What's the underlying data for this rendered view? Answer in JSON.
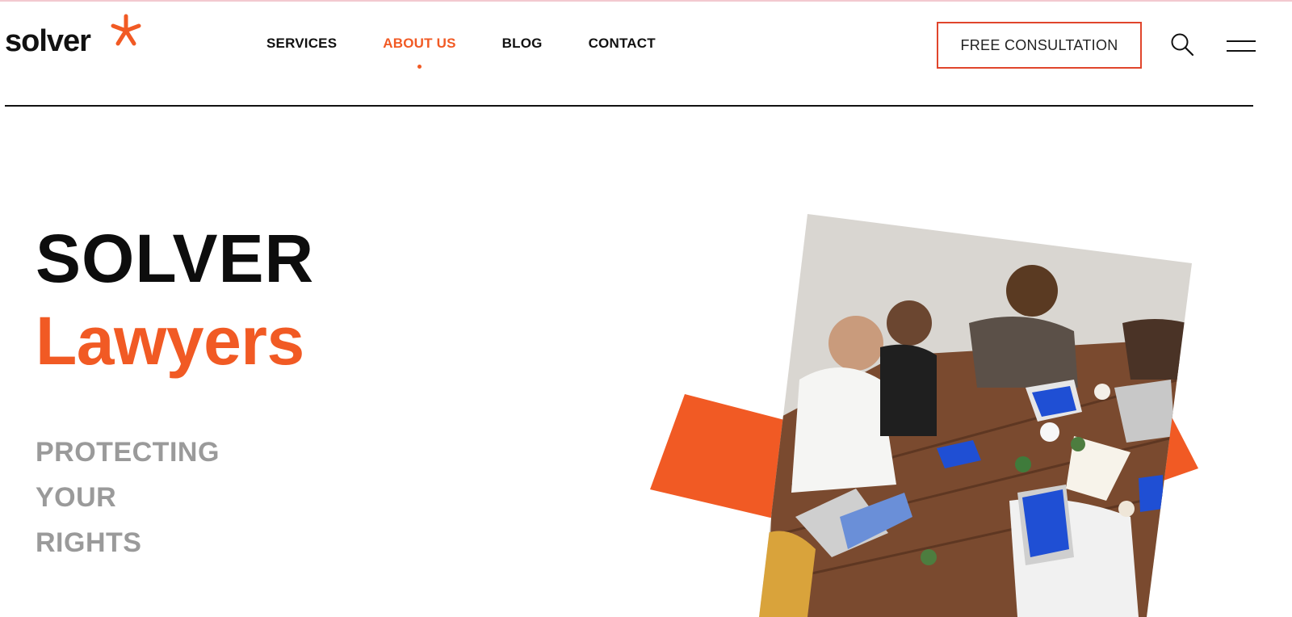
{
  "brand": {
    "name": "solver",
    "accent": "#f15a24"
  },
  "nav": {
    "items": [
      {
        "label": "SERVICES",
        "active": false
      },
      {
        "label": "ABOUT US",
        "active": true
      },
      {
        "label": "BLOG",
        "active": false
      },
      {
        "label": "CONTACT",
        "active": false
      }
    ]
  },
  "header": {
    "cta_label": "FREE CONSULTATION",
    "search_icon": "search-icon",
    "menu_icon": "hamburger-menu-icon"
  },
  "hero": {
    "title": "SOLVER",
    "subtitle": "Lawyers",
    "tagline": [
      "PROTECTING",
      "YOUR",
      "RIGHTS"
    ]
  }
}
